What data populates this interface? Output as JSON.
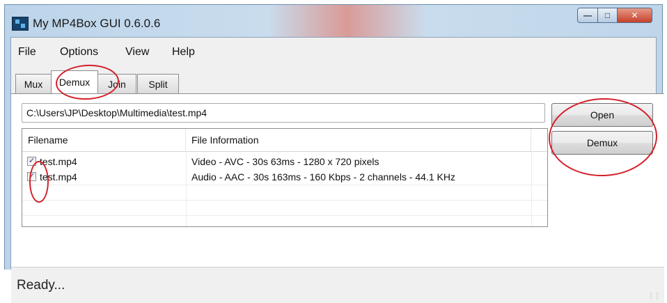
{
  "window": {
    "title": "My MP4Box GUI 0.6.0.6"
  },
  "menu": [
    "File",
    "Options",
    "View",
    "Help"
  ],
  "tabs": [
    {
      "label": "Mux",
      "active": false
    },
    {
      "label": "Demux",
      "active": true
    },
    {
      "label": "Join",
      "active": false
    },
    {
      "label": "Split",
      "active": false
    }
  ],
  "demux": {
    "path_value": "C:\\Users\\JP\\Desktop\\Multimedia\\test.mp4",
    "open_label": "Open",
    "demux_label": "Demux",
    "columns": [
      "Filename",
      "File Information"
    ],
    "rows": [
      {
        "checked": true,
        "filename": "test.mp4",
        "info": "Video - AVC - 30s 63ms - 1280 x 720 pixels"
      },
      {
        "checked": true,
        "filename": "test.mp4",
        "info": "Audio - AAC - 30s 163ms - 160 Kbps - 2 channels - 44.1 KHz"
      }
    ]
  },
  "status": {
    "text": "Ready..."
  },
  "icons": {
    "app": "app-icon",
    "minimize": "minimize-icon",
    "maximize": "maximize-icon",
    "close": "close-icon",
    "checkmark": "checkmark-icon",
    "grip": "resize-grip-icon"
  },
  "colors": {
    "annotation": "#d3202a",
    "titlebar": "#bcd4ea",
    "close_button": "#c7412a"
  }
}
